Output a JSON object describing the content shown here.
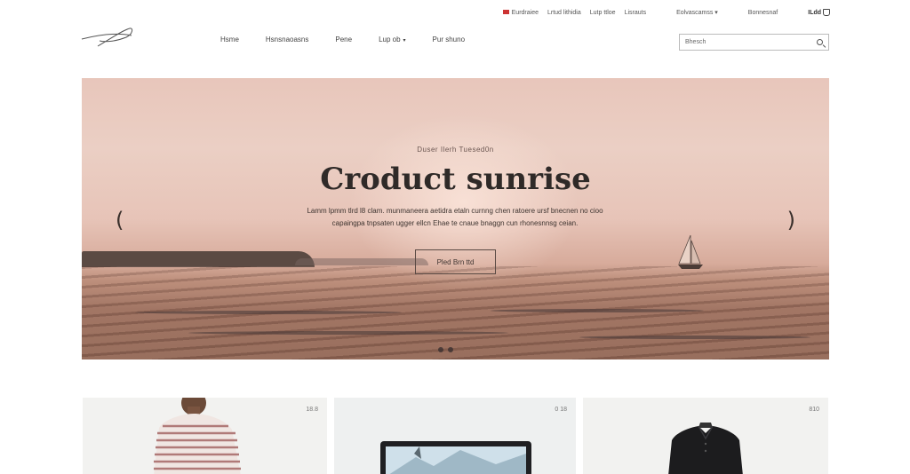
{
  "utility_bar": {
    "items": [
      "Eurdraiee",
      "Lrtud lithidia",
      "Lutp ttloe",
      "Lisrauts"
    ],
    "account": "Eolvascamss",
    "account_caret": "▾",
    "login": "Bonnesnaf",
    "cart_label": "ILdd"
  },
  "header": {
    "logo_alt": "",
    "nav": [
      {
        "label": "Hsme"
      },
      {
        "label": "Hsnsnaoasns"
      },
      {
        "label": "Pene"
      },
      {
        "label": "Lup ob",
        "caret": "▾"
      },
      {
        "label": "Pur shuno"
      }
    ],
    "search_placeholder": "Bhesch"
  },
  "hero": {
    "eyebrow": "Duser Ilerh Tuesed0n",
    "title": "Croduct sunrise",
    "description_line1": "Lamm lpmm tlrd l8 clam. munmaneera aetidra etaln curnng chen ratoere ursf bnecnen no cioo",
    "description_line2": "capaingpa tnpsaten ugger ellcn Ehae te cnaue bnaggn cun rhonesnnsg ceian.",
    "cta_label": "Pled Brn ttd",
    "prev_arrow": "(",
    "next_arrow": ")",
    "slide_count": 2,
    "active_slide": 1
  },
  "products": [
    {
      "price": "18.8",
      "name": "Striped shirt"
    },
    {
      "price": "0 18",
      "name": "Laptop"
    },
    {
      "price": "810",
      "name": "Black polo"
    }
  ],
  "colors": {
    "hero_sky": "#e8c6bb",
    "hero_water": "#8e6453",
    "text_dark": "#2f2a28"
  }
}
